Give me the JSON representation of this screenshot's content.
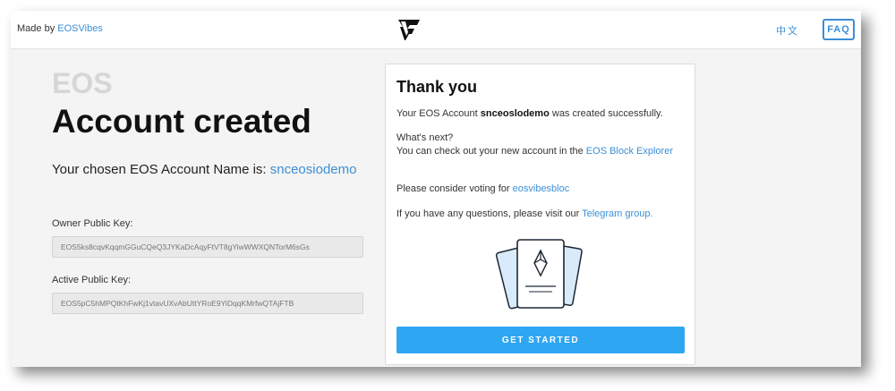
{
  "header": {
    "made_by_prefix": "Made by",
    "made_by_link": "EOSVibes",
    "language": "中文",
    "faq": "FAQ"
  },
  "left": {
    "eos_word": "EOS",
    "title": "Account created",
    "chosen_prefix": "Your chosen EOS Account Name is:",
    "chosen_account": "snceosiodemo",
    "owner_label": "Owner Public Key:",
    "owner_key": "EOS5ks8cqvKqqmGGuCQeQ3JYKaDcAqyFtVT8gYiwWWXQNTorM6sGs",
    "active_label": "Active Public Key:",
    "active_key": "EOS5pC5hMPQtKhFwKj1vtavUXvAbUttYRoE9YiDqqKMrfwQTAjFTB"
  },
  "card": {
    "title": "Thank you",
    "line1_prefix": "Your EOS Account",
    "line1_account": "snceoslodemo",
    "line1_suffix": "was created successfully.",
    "whats_next": "What's next?",
    "explorer_prefix": "You can check out your new account in the",
    "explorer_link": "EOS Block Explorer",
    "voting_prefix": "Please consider voting for",
    "voting_link": "eosvibesbloc",
    "questions_prefix": "If you have any questions, please visit our",
    "questions_link": "Telegram group.",
    "cta": "GET STARTED"
  },
  "icons": {
    "logo": "eosvibes-logo",
    "illustration": "eos-certificate-illustration"
  },
  "colors": {
    "accent": "#3b8fd6",
    "button": "#2ea6f2"
  }
}
